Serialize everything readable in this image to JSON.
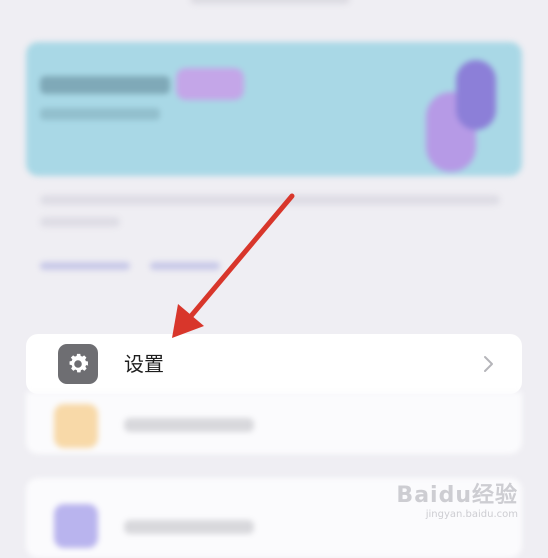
{
  "settings_item": {
    "label": "设置"
  },
  "watermark": {
    "brand": "Baidu经验",
    "sub": "jingyan.baidu.com"
  },
  "colors": {
    "annotation_arrow": "#d8362b",
    "banner": "#a9d8e6"
  },
  "icons": {
    "settings": "gear-icon",
    "chevron": "chevron-right-icon"
  }
}
